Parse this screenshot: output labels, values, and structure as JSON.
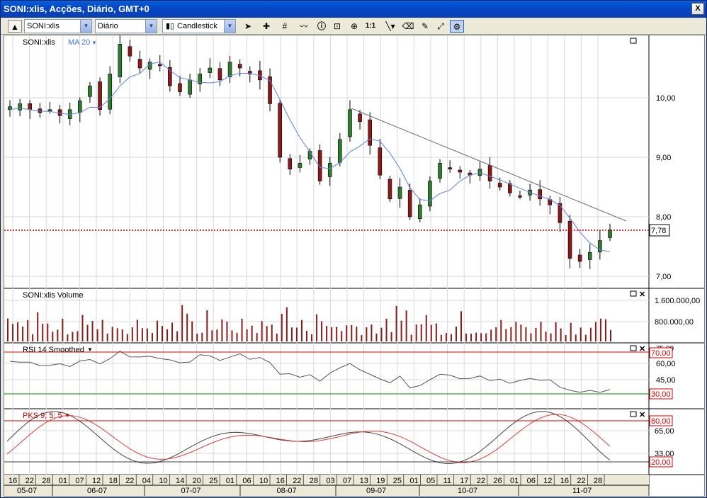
{
  "window": {
    "title": "SONI:xlis, Acções, Diário, GMT+0",
    "close": "X"
  },
  "toolbar": {
    "symbol": "SONI:xlis",
    "period": "Diário",
    "chart_type": "Candlestick",
    "icons": [
      "cursor-icon",
      "crosshair-icon",
      "grid-icon",
      "indicator-icon",
      "info-icon",
      "zoom-area-icon",
      "zoom-icon",
      "zoom-1to1-label",
      "trendline-icon",
      "eraser-icon",
      "paint-icon",
      "magic-icon",
      "active-tool-icon"
    ],
    "ratio_label": "1:1"
  },
  "panes": {
    "price": {
      "legend": "SONI:xlis",
      "ma": "MA 20",
      "current": "7,78",
      "ticks": [
        "10,00",
        "9,00",
        "8,00",
        "7,00"
      ]
    },
    "volume": {
      "legend": "SONI:xlis Volume",
      "ticks": [
        "1.600.000,00",
        "800.000,00"
      ]
    },
    "rsi": {
      "legend": "RSI 14 Smoothed",
      "ticks": [
        "75,00",
        "60,00",
        "45,00"
      ],
      "upper": "70,00",
      "lower": "30,00"
    },
    "pks": {
      "legend": "PKS 9; 5; 5",
      "ticks": [
        "65,00",
        "33,00"
      ],
      "upper": "80,00",
      "lower": "20,00"
    }
  },
  "xaxis": {
    "days": [
      "16",
      "22",
      "28",
      "01",
      "07",
      "12",
      "18",
      "22",
      "04",
      "10",
      "14",
      "20",
      "25",
      "01",
      "06",
      "10",
      "16",
      "22",
      "28",
      "03",
      "07",
      "13",
      "19",
      "25",
      "01",
      "05",
      "11",
      "17",
      "22",
      "26",
      "01",
      "06",
      "12",
      "16",
      "22",
      "28"
    ],
    "months": [
      "05-07",
      "06-07",
      "07-07",
      "08-07",
      "09-07",
      "10-07",
      "11-07"
    ]
  },
  "chart_data": {
    "type": "candlestick",
    "price_range": [
      6.9,
      10.9
    ],
    "close_series": [
      9.85,
      9.9,
      9.8,
      9.75,
      9.8,
      9.7,
      9.8,
      9.95,
      10.2,
      9.8,
      10.4,
      10.9,
      10.7,
      10.5,
      10.6,
      10.55,
      10.2,
      10.1,
      10.3,
      10.4,
      10.5,
      10.3,
      10.6,
      10.5,
      10.4,
      10.3,
      9.9,
      9.0,
      8.8,
      8.9,
      9.1,
      8.6,
      8.9,
      9.3,
      9.8,
      9.6,
      9.2,
      8.7,
      8.3,
      8.5,
      8.0,
      8.2,
      8.6,
      8.9,
      8.8,
      8.75,
      8.7,
      8.8,
      8.6,
      8.5,
      8.4,
      8.35,
      8.45,
      8.3,
      8.2,
      7.9,
      7.3,
      7.25,
      7.4,
      7.6,
      7.78
    ],
    "volume_range": [
      0,
      1900000
    ],
    "rsi": {
      "upper": 70,
      "lower": 30
    },
    "pks": {
      "upper": 80,
      "lower": 20
    }
  }
}
